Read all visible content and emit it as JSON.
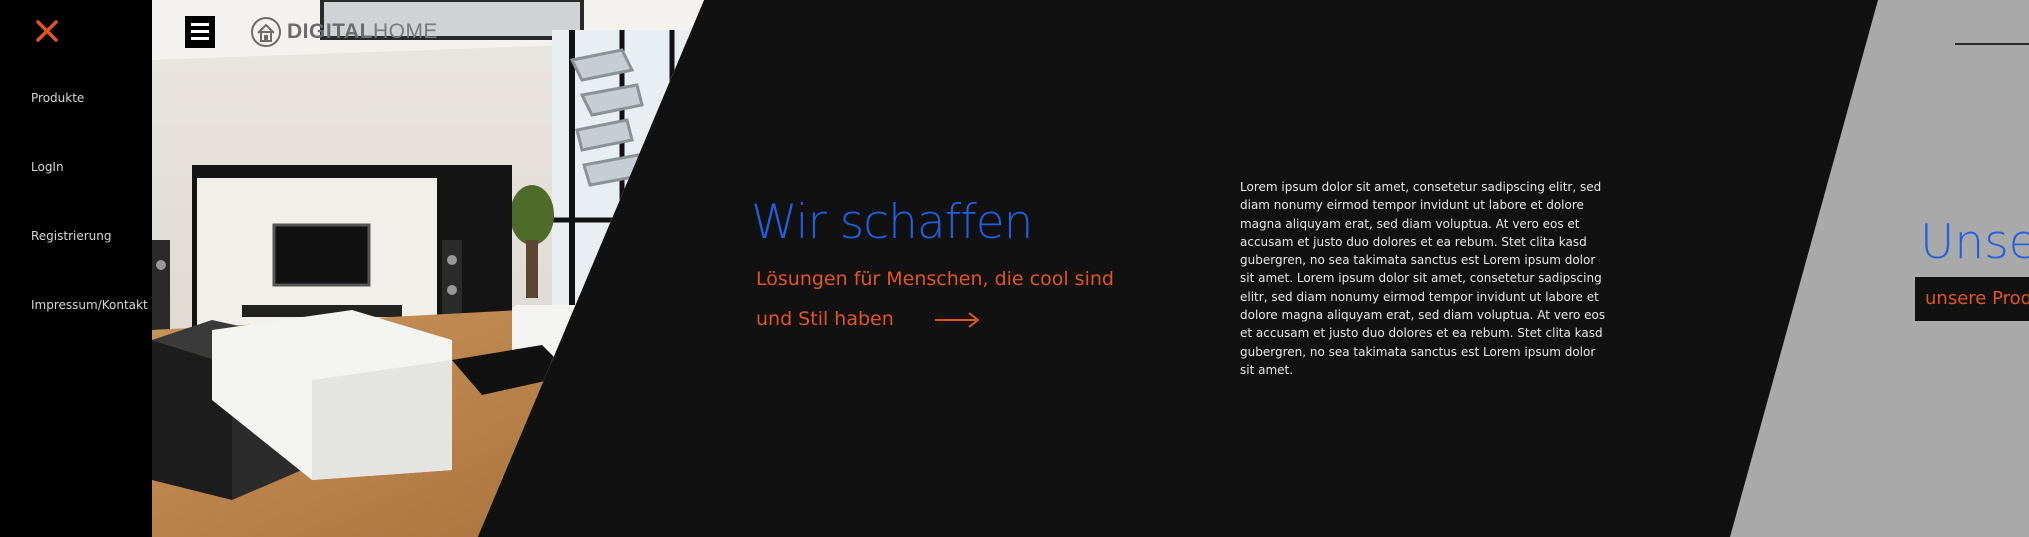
{
  "colors": {
    "accent_orange": "#e2551f",
    "accent_blue": "#1f5fe0",
    "dark_bg": "#111111",
    "menu_bg": "#000000",
    "panel_grey": "#a9a9a9"
  },
  "sidemenu": {
    "close_icon": "close-x-icon",
    "items": [
      {
        "label": "Produkte"
      },
      {
        "label": "LogIn"
      },
      {
        "label": "Registrierung"
      },
      {
        "label": "Impressum/Kontakt"
      }
    ]
  },
  "header": {
    "menu_icon": "hamburger-icon",
    "logo_icon": "house-icon",
    "logo_bold": "DIGITAL",
    "logo_light": "HOME"
  },
  "hero": {
    "image": "living-room-photo"
  },
  "main": {
    "headline": "Wir schaffen",
    "subline_1": "Lösungen für Menschen, die cool sind",
    "subline_2": "und Stil haben",
    "arrow_icon": "arrow-right-icon",
    "body": "Lorem ipsum dolor sit amet, consetetur sadipscing elitr, sed diam nonumy eirmod tempor invidunt ut labore et dolore magna aliquyam erat, sed diam voluptua. At vero eos et accusam et justo duo dolores et ea rebum. Stet clita kasd gubergren, no sea takimata sanctus est Lorem ipsum dolor sit amet. Lorem ipsum dolor sit amet, consetetur sadipscing elitr, sed diam nonumy eirmod tempor invidunt ut labore et dolore magna aliquyam erat, sed diam voluptua. At vero eos et accusam et justo duo dolores et ea rebum. Stet clita kasd gubergren, no sea takimata sanctus est Lorem ipsum dolor sit amet."
  },
  "right_panel": {
    "heading": "Unse",
    "button_label": "unsere Prod"
  }
}
